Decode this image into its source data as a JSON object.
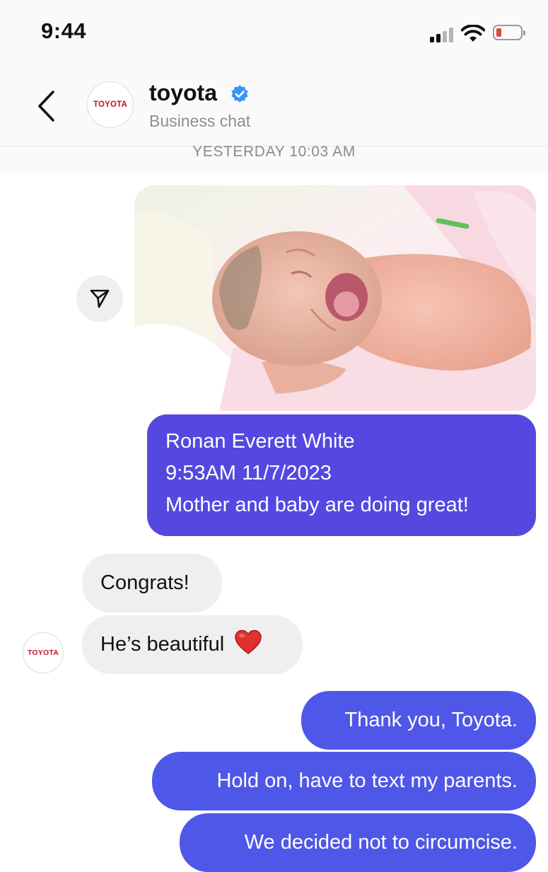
{
  "status_bar": {
    "time": "9:44",
    "battery_color": "#e0463c"
  },
  "header": {
    "back_icon": "chevron-left-icon",
    "avatar_logo": "TOYOTA",
    "name": "toyota",
    "verified_icon": "verified-badge-icon",
    "subtitle": "Business chat"
  },
  "timestamp": "YESTERDAY 10:03 AM",
  "messages": {
    "photo_icon": "newborn-photo",
    "share_icon": "send-icon",
    "announcement": {
      "line1": "Ronan Everett White",
      "line2": "9:53AM 11/7/2023",
      "line3": "Mother and baby are doing great!"
    },
    "reply1": "Congrats!",
    "reply2": "He’s beautiful",
    "reply2_emoji": "heart-icon",
    "msg_avatar_logo": "TOYOTA",
    "out1": "Thank you, Toyota.",
    "out2": "Hold on, have to text my parents.",
    "out3": "We decided not to circumcise."
  },
  "colors": {
    "outgoing_bubble": "#4f57e8",
    "incoming_bubble": "#efefef",
    "verified": "#3897f0",
    "toyota_red": "#c8102e"
  }
}
